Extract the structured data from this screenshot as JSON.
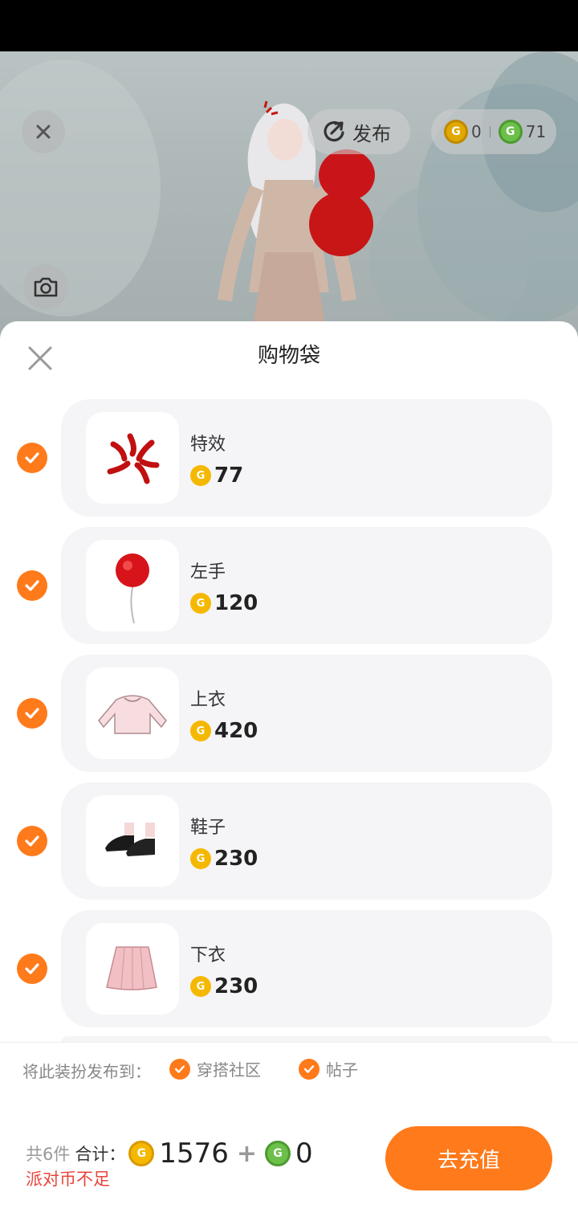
{
  "header": {
    "publish_label": "发布",
    "coin_gold_count": "0",
    "coin_green_count": "71"
  },
  "sheet": {
    "title": "购物袋",
    "items": [
      {
        "name": "特效",
        "price": "77"
      },
      {
        "name": "左手",
        "price": "120"
      },
      {
        "name": "上衣",
        "price": "420"
      },
      {
        "name": "鞋子",
        "price": "230"
      },
      {
        "name": "下衣",
        "price": "230"
      }
    ]
  },
  "publish": {
    "label": "将此装扮发布到：",
    "options": [
      "穿搭社区",
      "帖子"
    ]
  },
  "footer": {
    "count_text": "共6件",
    "total_label": "合计：",
    "gold_total": "1576",
    "plus": "+",
    "green_total": "0",
    "warning": "派对币不足",
    "recharge_label": "去充值"
  },
  "colors": {
    "accent": "#ff7a1a",
    "warning": "#e8453c",
    "gold_coin": "#f5b800",
    "green_coin": "#6cc04a"
  },
  "icons": [
    "close-icon",
    "publish-icon",
    "camera-icon",
    "check-icon",
    "gold-coin-icon",
    "green-coin-icon"
  ]
}
